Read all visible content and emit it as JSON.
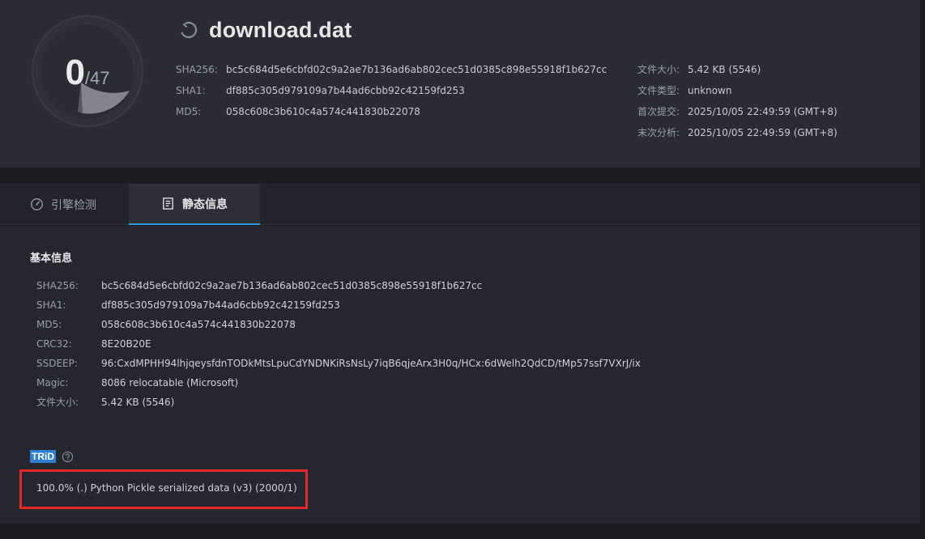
{
  "header": {
    "score": {
      "detected": "0",
      "total": "/47"
    },
    "title": "download.dat",
    "title_icon": "loading-circle-icon",
    "hashes": [
      {
        "label": "SHA256:",
        "value": "bc5c684d5e6cbfd02c9a2ae7b136ad6ab802cec51d0385c898e55918f1b627cc"
      },
      {
        "label": "SHA1:",
        "value": "df885c305d979109a7b44ad6cbb92c42159fd253"
      },
      {
        "label": "MD5:",
        "value": "058c608c3b610c4a574c441830b22078"
      }
    ],
    "meta": [
      {
        "label": "文件大小:",
        "value": "5.42 KB (5546)"
      },
      {
        "label": "文件类型:",
        "value": "unknown"
      },
      {
        "label": "首次提交:",
        "value": "2025/10/05 22:49:59 (GMT+8)"
      },
      {
        "label": "末次分析:",
        "value": "2025/10/05 22:49:59 (GMT+8)"
      }
    ]
  },
  "tabs": [
    {
      "label": "引擎检测",
      "icon": "gauge-icon",
      "active": false
    },
    {
      "label": "静态信息",
      "icon": "document-icon",
      "active": true
    }
  ],
  "basic_info": {
    "title": "基本信息",
    "rows": [
      {
        "label": "SHA256:",
        "value": "bc5c684d5e6cbfd02c9a2ae7b136ad6ab802cec51d0385c898e55918f1b627cc"
      },
      {
        "label": "SHA1:",
        "value": "df885c305d979109a7b44ad6cbb92c42159fd253"
      },
      {
        "label": "MD5:",
        "value": "058c608c3b610c4a574c441830b22078"
      },
      {
        "label": "CRC32:",
        "value": "8E20B20E"
      },
      {
        "label": "SSDEEP:",
        "value": "96:CxdMPHH94lhjqeysfdnTODkMtsLpuCdYNDNKiRsNsLy7iqB6qjeArx3H0q/HCx:6dWelh2QdCD/tMp57ssf7VXrJ/ix"
      },
      {
        "label": "Magic:",
        "value": "8086 relocatable (Microsoft)"
      },
      {
        "label": "文件大小:",
        "value": "5.42 KB (5546)"
      }
    ]
  },
  "trid": {
    "badge": "TRiD",
    "help_icon": "question-circle-icon",
    "result": "100.0% (.) Python Pickle serialized data (v3) (2000/1)"
  },
  "colors": {
    "accent": "#2b96d8",
    "highlight_border": "#e3282b",
    "trid_badge": "#2f7fd0"
  }
}
